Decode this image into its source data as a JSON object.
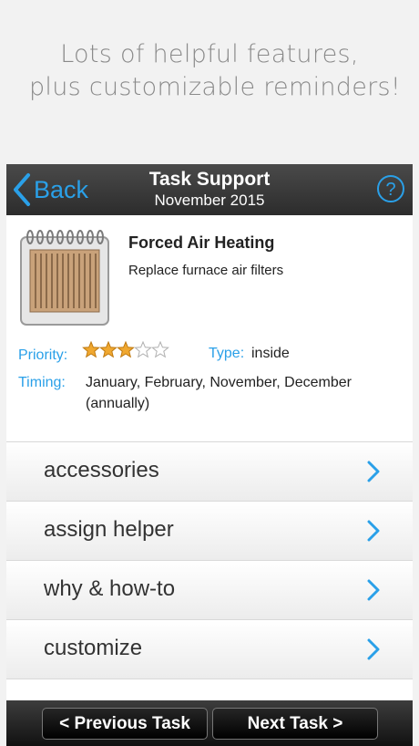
{
  "promo": {
    "line1": "Lots of helpful features,",
    "line2": "plus customizable reminders!"
  },
  "navbar": {
    "back_label": "Back",
    "title": "Task Support",
    "subtitle": "November 2015"
  },
  "task": {
    "title": "Forced Air Heating",
    "subtitle": "Replace furnace air filters",
    "priority_label": "Priority:",
    "priority_rating": 3,
    "priority_max": 5,
    "type_label": "Type:",
    "type_value": "inside",
    "timing_label": "Timing:",
    "timing_value_line1": "January, February, November, December",
    "timing_value_line2": "(annually)"
  },
  "menu": {
    "items": [
      {
        "label": "accessories"
      },
      {
        "label": "assign helper"
      },
      {
        "label": "why & how-to"
      },
      {
        "label": "customize"
      }
    ]
  },
  "bottom": {
    "prev_label": "< Previous Task",
    "next_label": "Next Task >"
  },
  "colors": {
    "accent": "#2aa0e8",
    "star": "#f0a830"
  }
}
